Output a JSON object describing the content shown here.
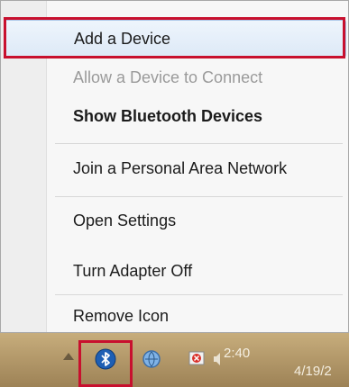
{
  "context_menu": {
    "items": [
      {
        "label": "Add a Device",
        "state": "highlighted"
      },
      {
        "label": "Allow a Device to Connect",
        "state": "disabled"
      },
      {
        "label": "Show Bluetooth Devices",
        "state": "default"
      },
      {
        "label": "Join a Personal Area Network",
        "state": "normal"
      },
      {
        "label": "Open Settings",
        "state": "normal"
      },
      {
        "label": "Turn Adapter Off",
        "state": "normal"
      },
      {
        "label": "Remove Icon",
        "state": "normal"
      }
    ]
  },
  "taskbar": {
    "tray_icons": [
      "show-hidden-icons-arrow",
      "bluetooth-icon",
      "network-icon",
      "flag-icon",
      "volume-icon"
    ],
    "clock_time": "2:40",
    "clock_date": "4/19/2"
  },
  "colors": {
    "annotation_red": "#c8102e",
    "bluetooth_blue": "#1e5fb4",
    "taskbar": "#b3986a"
  }
}
